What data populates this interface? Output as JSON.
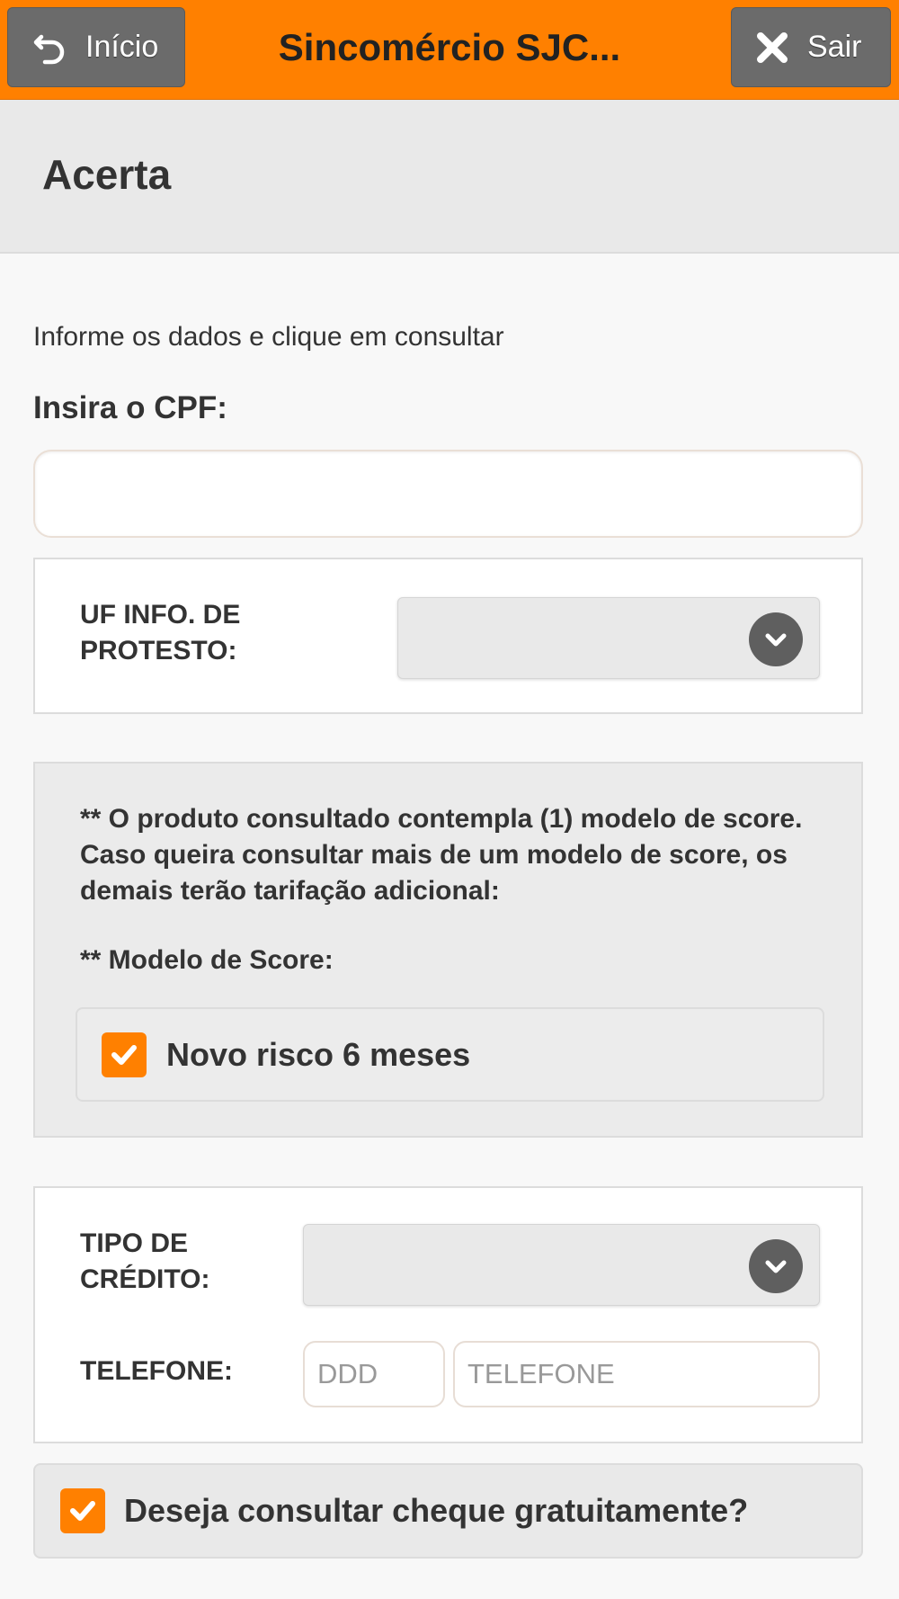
{
  "header": {
    "home_label": "Início",
    "title": "Sincomércio SJC...",
    "exit_label": "Sair"
  },
  "page": {
    "title": "Acerta",
    "intro": "Informe os dados e clique em consultar",
    "cpf_label": "Insira o CPF:",
    "cpf_value": ""
  },
  "uf_protesto": {
    "label_line1": "UF INFO. DE",
    "label_line2": "PROTESTO:",
    "selected": ""
  },
  "score": {
    "notice": "** O produto consultado contempla (1) modelo de score. Caso queira consultar mais de um modelo de score, os demais terão tarifação adicional:",
    "model_label": "** Modelo de Score:",
    "option_label": "Novo risco 6 meses",
    "option_checked": true
  },
  "credit": {
    "type_label_line1": "TIPO DE",
    "type_label_line2": "CRÉDITO:",
    "type_selected": "",
    "phone_label": "TELEFONE:",
    "ddd_placeholder": "DDD",
    "phone_placeholder": "TELEFONE"
  },
  "cheque": {
    "label": "Deseja consultar cheque gratuitamente?",
    "checked": true
  },
  "colors": {
    "accent": "#ff8000",
    "header_button": "#6b6b6b",
    "chevron": "#5f5f5f"
  }
}
